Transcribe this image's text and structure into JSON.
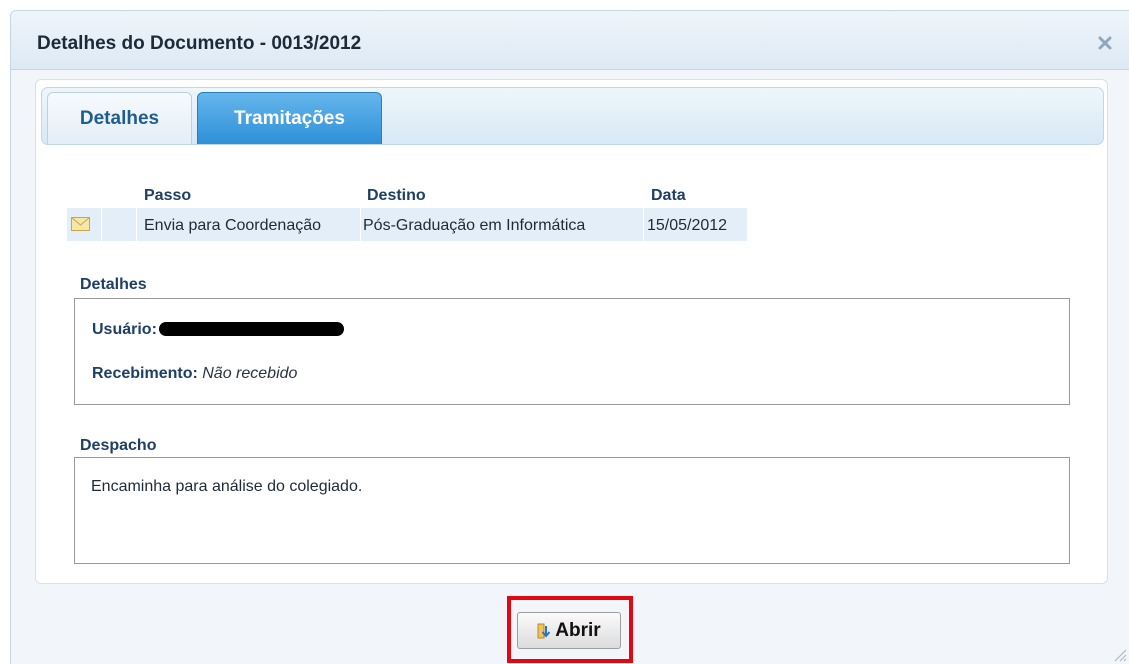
{
  "dialog": {
    "title": "Detalhes do Documento - 0013/2012",
    "close_icon": "close-icon"
  },
  "tabs": [
    {
      "label": "Detalhes",
      "active": false
    },
    {
      "label": "Tramitações",
      "active": true
    }
  ],
  "table": {
    "columns": [
      "Passo",
      "Destino",
      "Data"
    ],
    "rows": [
      {
        "icon": "mail-icon",
        "passo": "Envia para Coordenação",
        "destino": "Pós-Graduação em Informática",
        "data": "15/05/2012"
      }
    ]
  },
  "detalhes": {
    "section_label": "Detalhes",
    "usuario_label": "Usuário:",
    "recebimento_label": "Recebimento:",
    "recebimento_value": "Não recebido"
  },
  "despacho": {
    "section_label": "Despacho",
    "text": "Encaminha para análise do colegiado."
  },
  "button": {
    "label": "Abrir",
    "icon": "folder-open-icon"
  },
  "colors": {
    "highlight": "#e30613",
    "active_tab": "#2e90d8",
    "header_text": "#1e3f66"
  }
}
